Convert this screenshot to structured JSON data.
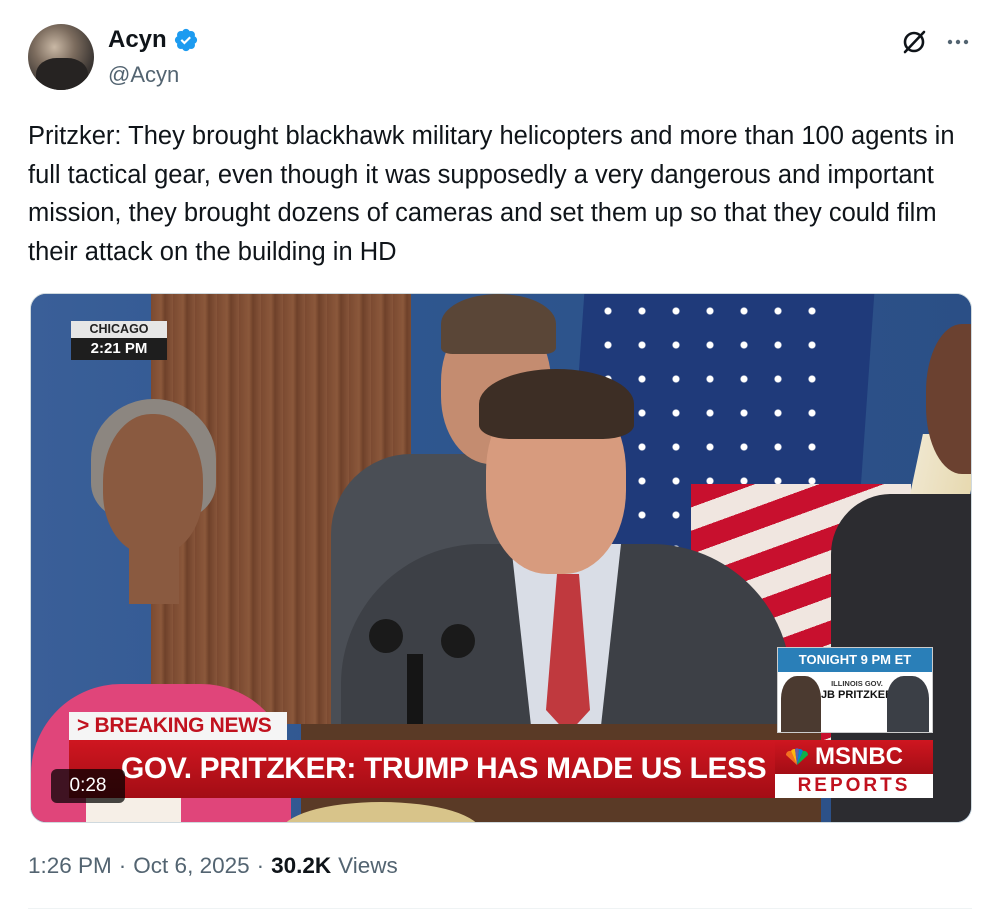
{
  "author": {
    "display_name": "Acyn",
    "handle": "@Acyn",
    "verified": true
  },
  "tweet": {
    "text": "Pritzker: They brought blackhawk military helicopters and more than 100 agents in full tactical gear, even though it was supposedly a very dangerous and important mission, they brought dozens of cameras and set them up so that they could film their attack on the building in HD"
  },
  "video": {
    "duration": "0:28",
    "location_label": "CHICAGO",
    "location_time": "2:21 PM",
    "promo_header": "TONIGHT 9 PM ET",
    "promo_subtitle": "ILLINOIS GOV.",
    "promo_name": "JB PRITZKER",
    "breaking_label": "> BREAKING NEWS",
    "chyron_text": "GOV. PRITZKER: TRUMP HAS MADE US LESS SAFE",
    "network_name": "MSNBC",
    "network_program": "REPORTS"
  },
  "meta": {
    "time": "1:26 PM",
    "separator": "·",
    "date": "Oct 6, 2025",
    "views_count": "30.2K",
    "views_label": "Views"
  },
  "colors": {
    "verified_blue": "#1d9bf0",
    "chyron_red": "#c1121f",
    "secondary_text": "#536471"
  },
  "icons": {
    "verified": "verified-badge-icon",
    "grok": "grok-icon",
    "more": "more-icon",
    "peacock": "peacock-icon"
  }
}
